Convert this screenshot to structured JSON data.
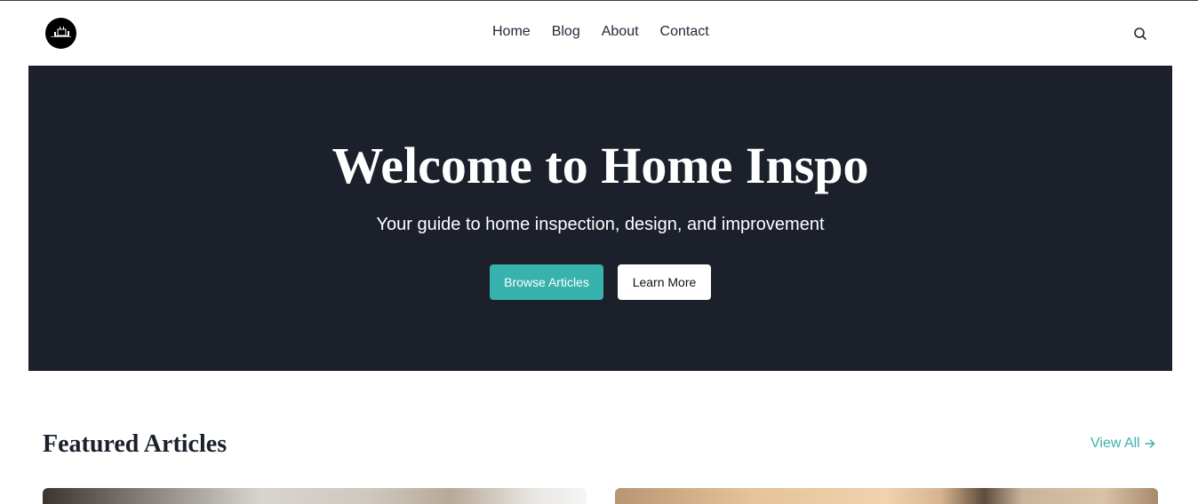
{
  "header": {
    "logo_icon": "home-logo-icon",
    "nav": [
      {
        "label": "Home"
      },
      {
        "label": "Blog"
      },
      {
        "label": "About"
      },
      {
        "label": "Contact"
      }
    ],
    "search_icon": "search-icon"
  },
  "hero": {
    "title": "Welcome to Home Inspo",
    "subtitle": "Your guide to home inspection, design, and improvement",
    "primary_button": "Browse Articles",
    "secondary_button": "Learn More",
    "background_color": "#1b202b",
    "accent_color": "#38b2ac"
  },
  "featured": {
    "title": "Featured Articles",
    "view_all": "View All",
    "view_all_icon": "arrow-right-icon"
  }
}
